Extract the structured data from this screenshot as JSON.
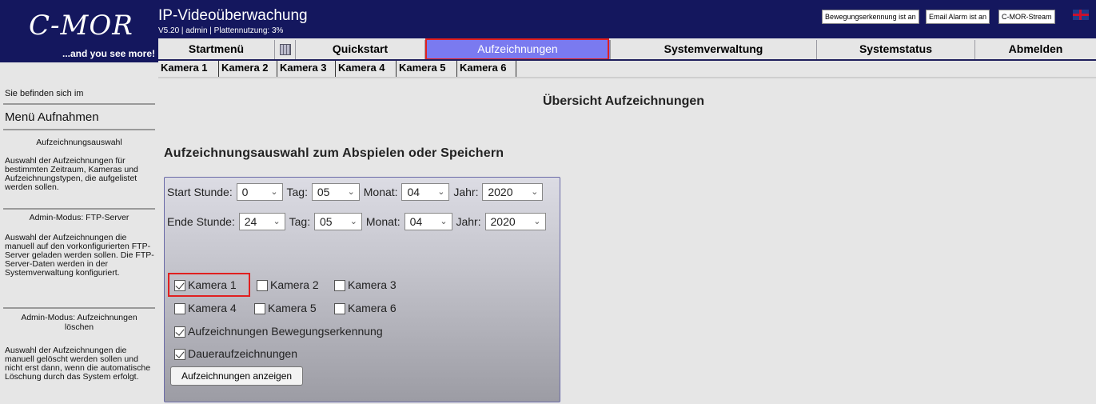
{
  "logo": {
    "brand": "C-MOR",
    "tagline": "...and you see more!"
  },
  "header": {
    "title": "IP-Videoüberwachung",
    "subtitle": "V5.20 | admin | Plattennutzung: 3%",
    "status_buttons": [
      "Bewegungserkennung ist an",
      "Email Alarm ist an",
      "C-MOR-Stream"
    ],
    "flag_icon": "uk-flag-icon"
  },
  "nav": {
    "items": [
      "Startmenü",
      "",
      "Quickstart",
      "Aufzeichnungen",
      "Systemverwaltung",
      "Systemstatus",
      "Abmelden"
    ],
    "active": "Aufzeichnungen",
    "active_color": "#7a7af0"
  },
  "cameras_nav": [
    "Kamera 1",
    "Kamera 2",
    "Kamera 3",
    "Kamera 4",
    "Kamera 5",
    "Kamera 6"
  ],
  "sidebar": {
    "location_label": "Sie befinden sich im",
    "menu_title": "Menü Aufnahmen",
    "sections": [
      {
        "head": "Aufzeichnungsauswahl",
        "text": "Auswahl der Aufzeichnungen für bestimmten Zeitraum, Kameras und Aufzeichnungstypen, die aufgelistet werden sollen."
      },
      {
        "head": "Admin-Modus: FTP-Server",
        "text": "Auswahl der Aufzeichnungen die manuell auf den vorkonfigurierten FTP-Server geladen werden sollen. Die FTP-Server-Daten werden in der Systemverwaltung konfiguriert."
      },
      {
        "head": "Admin-Modus: Aufzeichnungen löschen",
        "text": "Auswahl der Aufzeichnungen die manuell gelöscht werden sollen und nicht erst dann, wenn die automatische Löschung durch das System erfolgt."
      }
    ]
  },
  "main": {
    "page_title": "Übersicht Aufzeichnungen",
    "section_title": "Aufzeichnungsauswahl zum Abspielen oder Speichern",
    "start": {
      "label": "Start Stunde:",
      "hour": "0",
      "day_label": "Tag:",
      "day": "05",
      "month_label": "Monat:",
      "month": "04",
      "year_label": "Jahr:",
      "year": "2020"
    },
    "end": {
      "label": "Ende Stunde:",
      "hour": "24",
      "day_label": "Tag:",
      "day": "05",
      "month_label": "Monat:",
      "month": "04",
      "year_label": "Jahr:",
      "year": "2020"
    },
    "cameras": [
      {
        "label": "Kamera 1",
        "checked": true
      },
      {
        "label": "Kamera 2",
        "checked": false
      },
      {
        "label": "Kamera 3",
        "checked": false
      },
      {
        "label": "Kamera 4",
        "checked": false
      },
      {
        "label": "Kamera 5",
        "checked": false
      },
      {
        "label": "Kamera 6",
        "checked": false
      }
    ],
    "motion": {
      "label": "Aufzeichnungen Bewegungserkennung",
      "checked": true
    },
    "continuous": {
      "label": "Daueraufzeichnungen",
      "checked": true
    },
    "show_button": "Aufzeichnungen anzeigen",
    "highlight_color": "#e02020"
  }
}
